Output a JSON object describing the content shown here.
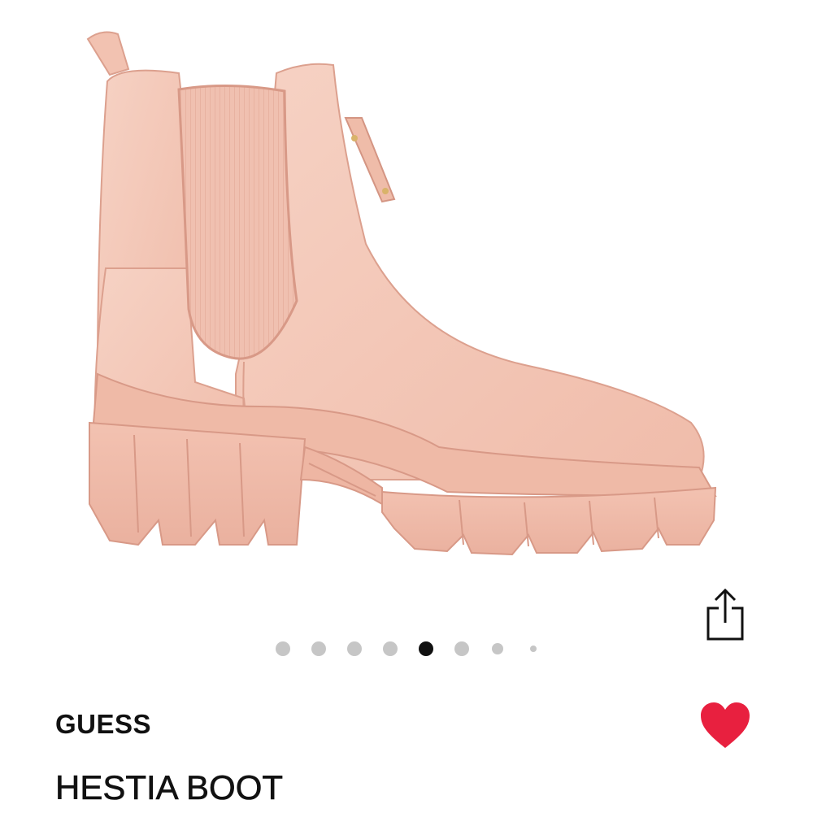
{
  "product": {
    "brand": "GUESS",
    "name": "HESTIA BOOT",
    "image_icon": "pink-chelsea-boot-image"
  },
  "gallery": {
    "total_images": 8,
    "active_index": 4
  },
  "actions": {
    "share_icon": "share-icon",
    "favorite_icon": "heart-icon",
    "favorited": true
  },
  "colors": {
    "boot": "#f4c8b8",
    "boot_shadow": "#e7ad9b",
    "boot_dark": "#d9998a",
    "heart": "#e8203f",
    "dot_active": "#111111",
    "dot_inactive": "#c6c6c6",
    "text": "#111111"
  }
}
